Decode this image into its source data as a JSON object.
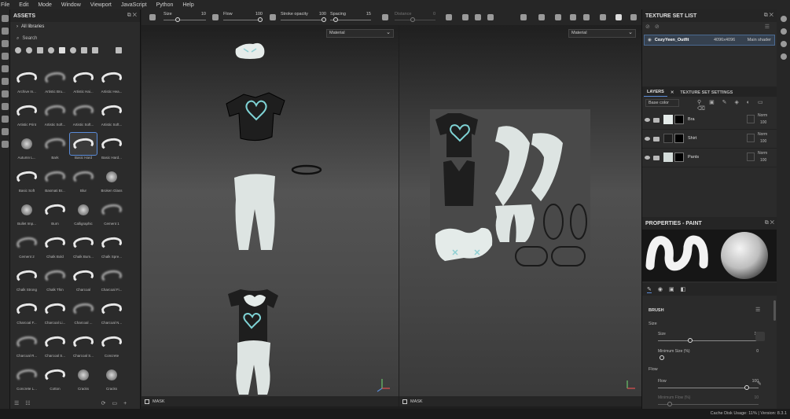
{
  "menu": [
    "File",
    "Edit",
    "Mode",
    "Window",
    "Viewport",
    "JavaScript",
    "Python",
    "Help"
  ],
  "assets": {
    "title": "ASSETS",
    "library": "All libraries",
    "search_placeholder": "Search",
    "brushes": [
      "Archive In...",
      "Artistic Bru...",
      "Artistic Hai...",
      "Artistic Hea...",
      "Artistic Print",
      "Artistic Soft...",
      "Artistic Soft...",
      "Artistic Soft...",
      "Autumn L...",
      "Bark",
      "Basic Hard",
      "Basic Hard...",
      "Basic Soft",
      "Basmati Br...",
      "Blur",
      "Broken Glass",
      "Bullet Imp...",
      "Burn",
      "Calligraphic",
      "Cement 1",
      "Cement 2",
      "Chalk Bold",
      "Chalk Bum...",
      "Chalk Spre...",
      "Chalk Strong",
      "Chalk Thin",
      "Charcoal",
      "Charcoal Fi...",
      "Charcoal F...",
      "Charcoal Li...",
      "Charcoal ...",
      "Charcoal N...",
      "Charcoal R...",
      "Charcoal S...",
      "Charcoal S...",
      "Concrete",
      "Concrete L...",
      "Cotton",
      "Cracks",
      "Cracks"
    ]
  },
  "toolbar": {
    "size_label": "Size",
    "size_value": "10",
    "flow_label": "Flow",
    "flow_value": "100",
    "stroke_opacity_label": "Stroke opacity",
    "stroke_opacity_value": "100",
    "spacing_label": "Spacing",
    "spacing_value": "15",
    "distance_label": "Distance",
    "distance_value": "0"
  },
  "viewports": {
    "left_material": "Material",
    "right_material": "Material",
    "mask_label": "MASK"
  },
  "texture_set_list": {
    "title": "TEXTURE SET LIST",
    "name": "CozyYeen_Outfit",
    "resolution": "4096x4096",
    "shader": "Main shader"
  },
  "layers_panel": {
    "tab_layers": "LAYERS",
    "tab_tss": "TEXTURE SET SETTINGS",
    "channel": "Base color",
    "layers": [
      {
        "name": "Bra",
        "blend": "Norm",
        "opacity": "100"
      },
      {
        "name": "Shirt",
        "blend": "Norm",
        "opacity": "100"
      },
      {
        "name": "Pants",
        "blend": "Norm",
        "opacity": "100"
      }
    ]
  },
  "properties": {
    "title": "PROPERTIES - PAINT",
    "brush_section": "BRUSH",
    "size_group": "Size",
    "size_label": "Size",
    "size_value": "10",
    "min_size_label": "Minimum Size (%)",
    "min_size_value": "0",
    "flow_group": "Flow",
    "flow_label": "Flow",
    "flow_value": "100",
    "min_flow_label": "Minimum Flow (%)",
    "min_flow_value": "10"
  },
  "status": "Cache Disk Usage:   11% | Version: 8.3.1",
  "colors": {
    "accent": "#5a8bd8",
    "panel": "#2b2b2b",
    "shirt": "#1e1e1e",
    "fabric": "#dfe6e3",
    "heart": "#7fd3d5"
  }
}
